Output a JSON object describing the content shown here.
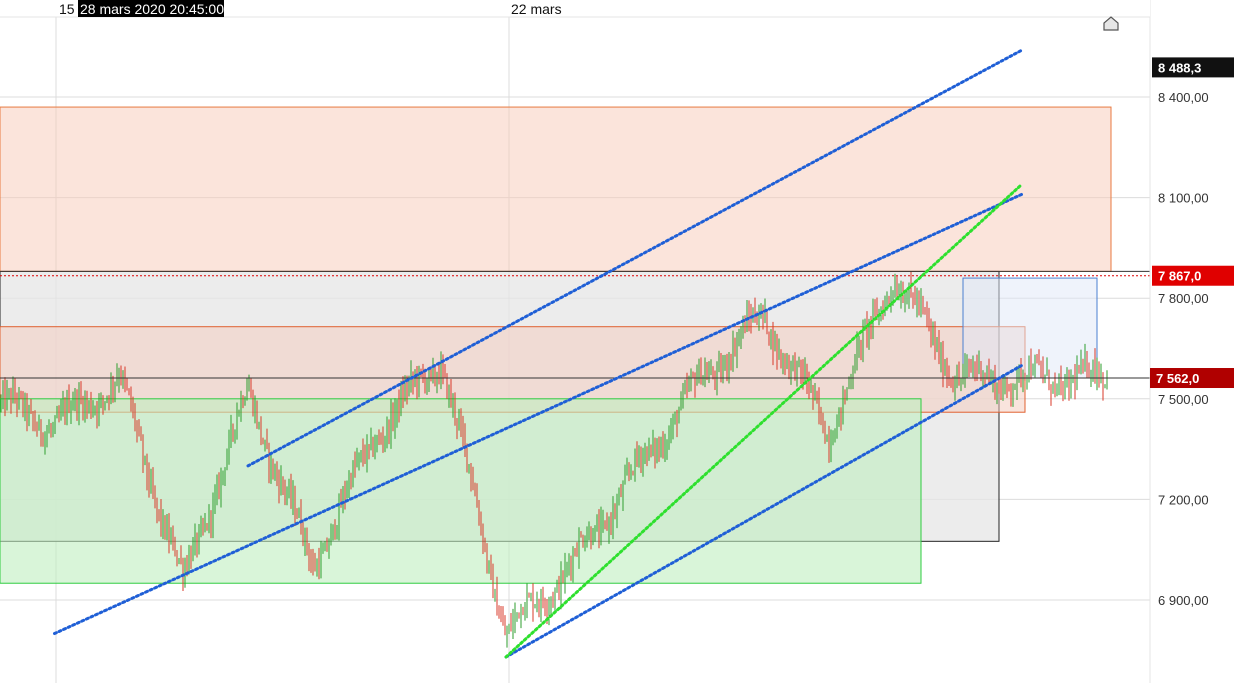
{
  "chart_data": {
    "type": "candlestick",
    "instrument_ref": "",
    "y_axis": {
      "range": [
        6750,
        8600
      ],
      "ticks": [
        {
          "value": 8400,
          "label": "8 400,00"
        },
        {
          "value": 8100,
          "label": "8 100,00"
        },
        {
          "value": 7800,
          "label": "7 800,00"
        },
        {
          "value": 7500,
          "label": "7 500,00"
        },
        {
          "value": 7200,
          "label": "7 200,00"
        },
        {
          "value": 6900,
          "label": "6 900,00"
        }
      ],
      "grid": true
    },
    "x_axis": {
      "labels": [
        {
          "text": "15",
          "tick": "15 mars"
        },
        {
          "text": "22 mars",
          "tick": "22 mars"
        }
      ],
      "cursor_label": "28 mars 2020 20:45:00"
    },
    "price_badges": [
      {
        "value": 8488.3,
        "label": "8 488,3",
        "color": "#111111"
      },
      {
        "value": 7867.0,
        "label": "7 867,0",
        "color": "#e00000"
      },
      {
        "value": 7562.0,
        "label": "7 562,0",
        "color": "#b00000"
      }
    ],
    "price_levels": [
      {
        "value": 7867,
        "style": "dotted",
        "color": "#e00000"
      },
      {
        "value": 7880,
        "style": "solid",
        "color": "#333333"
      },
      {
        "value": 7562,
        "style": "solid",
        "color": "#333333"
      }
    ],
    "zones": [
      {
        "name": "resistance zone",
        "from": 7880,
        "to": 8370,
        "color": "#f7c9b8",
        "border": "#e87a40"
      },
      {
        "name": "supply zone",
        "from": 7460,
        "to": 7715,
        "color": "#f3cabb",
        "border": "#e06030"
      },
      {
        "name": "demand zone",
        "from": 6950,
        "to": 7500,
        "color": "#bfefbf",
        "border": "#2ecc40"
      },
      {
        "name": "range box",
        "from": 7075,
        "to": 7880,
        "color": "#e6e6e6",
        "border": "#222222"
      },
      {
        "name": "recent range",
        "from": 7562,
        "to": 7860,
        "color": "#dfe8f8",
        "border": "#4a7fd0"
      }
    ],
    "trendlines": [
      {
        "name": "upper channel",
        "color": "#1f5fd6",
        "style": "dotted",
        "from": [
          "2020-03-17",
          7300
        ],
        "to": [
          "2020-03-29",
          8540
        ]
      },
      {
        "name": "middle channel",
        "color": "#1f5fd6",
        "style": "dotted",
        "from": [
          "2020-03-14",
          6800
        ],
        "to": [
          "2020-03-29",
          8110
        ]
      },
      {
        "name": "lower channel",
        "color": "#1f5fd6",
        "style": "dotted",
        "from": [
          "2020-03-21",
          6730
        ],
        "to": [
          "2020-03-29",
          7600
        ]
      },
      {
        "name": "rising support",
        "color": "#2ee02e",
        "style": "dotted",
        "from": [
          "2020-03-21",
          6730
        ],
        "to": [
          "2020-03-29",
          8140
        ]
      }
    ],
    "anchors": [
      {
        "time": "2020-03-13",
        "value": 7500
      },
      {
        "time": "2020-03-14",
        "value": 7420
      },
      {
        "time": "2020-03-15",
        "value": 7560
      },
      {
        "time": "2020-03-16",
        "value": 6950
      },
      {
        "time": "2020-03-17",
        "value": 7520
      },
      {
        "time": "2020-03-18",
        "value": 7000
      },
      {
        "time": "2020-03-19",
        "value": 7400
      },
      {
        "time": "2020-03-20",
        "value": 7620
      },
      {
        "time": "2020-03-21",
        "value": 6800
      },
      {
        "time": "2020-03-22",
        "value": 7000
      },
      {
        "time": "2020-03-23",
        "value": 7280
      },
      {
        "time": "2020-03-24",
        "value": 7550
      },
      {
        "time": "2020-03-25",
        "value": 7750
      },
      {
        "time": "2020-03-26",
        "value": 7400
      },
      {
        "time": "2020-03-27",
        "value": 7870
      },
      {
        "time": "2020-03-28",
        "value": 7562
      }
    ],
    "colors": {
      "up": "#2e9e2e",
      "down": "#d93a2a"
    },
    "marker": {
      "name": "home-icon"
    }
  }
}
